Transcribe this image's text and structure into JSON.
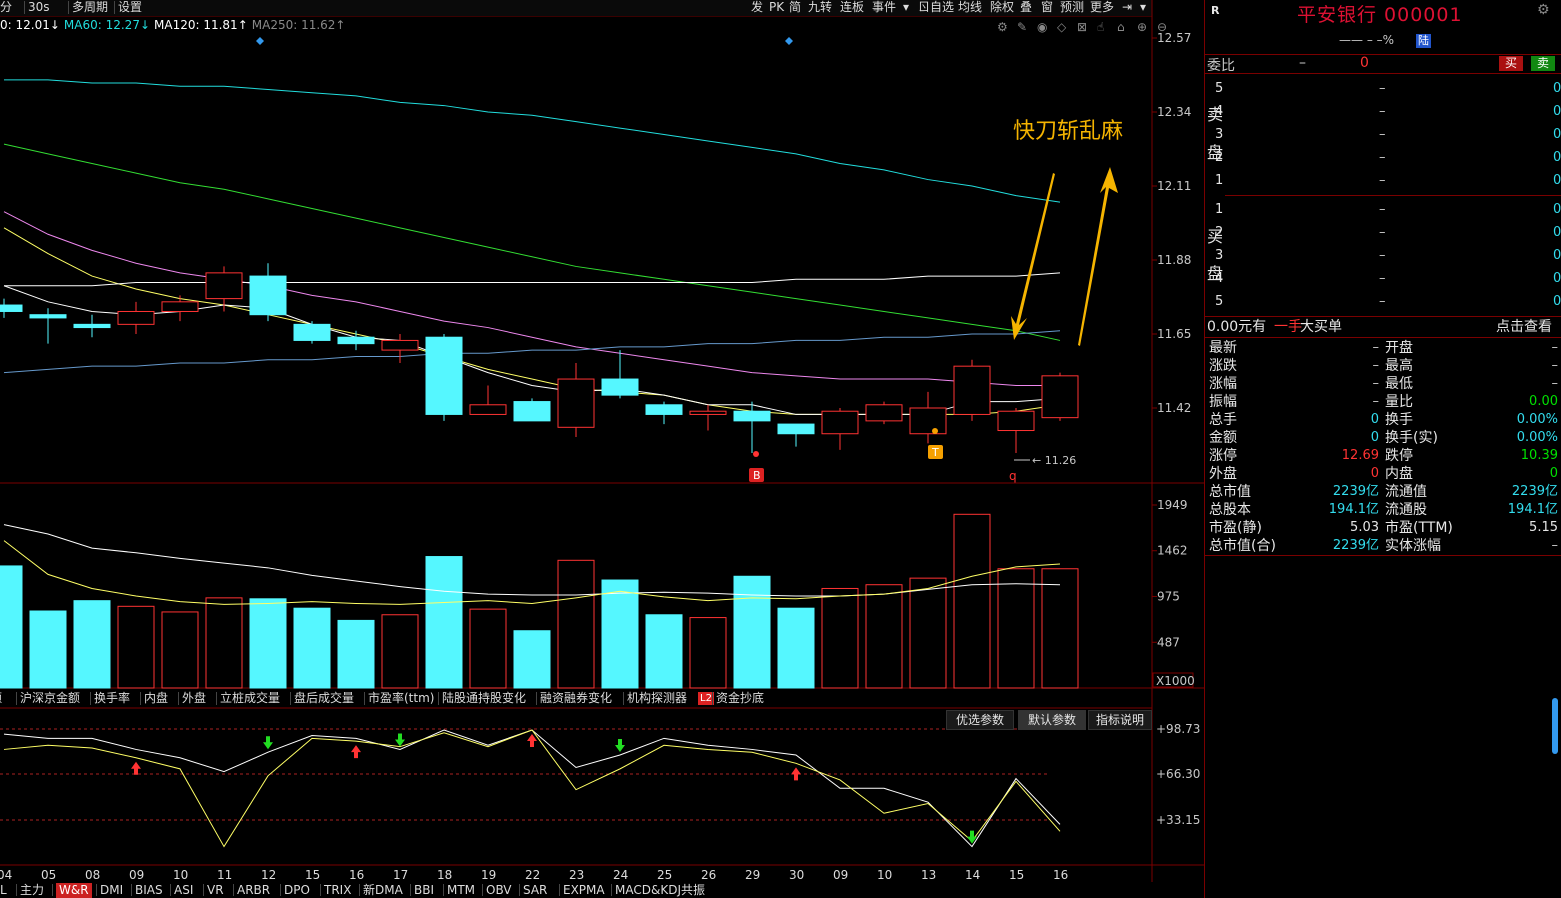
{
  "toolbar": {
    "left_items": [
      "分",
      "30s",
      "多周期",
      "设置"
    ],
    "right_items": [
      "发",
      "PK",
      "简",
      "九转",
      "连板",
      "事件",
      "▾",
      "ㄖ自选",
      "均线",
      "除权",
      "叠",
      "窗",
      "预测",
      "更多",
      "⇥",
      "▾"
    ]
  },
  "ma_legend": [
    {
      "label": "0: 12.01↓",
      "color": "#ffffff"
    },
    {
      "label": "MA60: 12.27↓",
      "color": "#22dddd"
    },
    {
      "label": "MA120: 11.81↑",
      "color": "#ffffff"
    },
    {
      "label": "MA250: 11.62↑",
      "color": "#888888"
    }
  ],
  "annotation": {
    "text": "快刀斩乱麻",
    "color": "#f5b400"
  },
  "markers": {
    "b": "B",
    "t": "T",
    "q": "q",
    "low_label": "11.26"
  },
  "chart_data": [
    {
      "type": "candlestick",
      "name": "price",
      "ylim": [
        11.2,
        12.62
      ],
      "y_ticks": [
        12.57,
        12.34,
        12.11,
        11.88,
        11.65,
        11.42
      ],
      "candles": [
        {
          "o": 11.74,
          "c": 11.72,
          "h": 11.76,
          "l": 11.7
        },
        {
          "o": 11.71,
          "c": 11.7,
          "h": 11.73,
          "l": 11.62
        },
        {
          "o": 11.68,
          "c": 11.67,
          "h": 11.71,
          "l": 11.64
        },
        {
          "o": 11.68,
          "c": 11.72,
          "h": 11.75,
          "l": 11.65
        },
        {
          "o": 11.72,
          "c": 11.75,
          "h": 11.77,
          "l": 11.69
        },
        {
          "o": 11.76,
          "c": 11.84,
          "h": 11.86,
          "l": 11.72
        },
        {
          "o": 11.83,
          "c": 11.71,
          "h": 11.87,
          "l": 11.69
        },
        {
          "o": 11.68,
          "c": 11.63,
          "h": 11.69,
          "l": 11.62
        },
        {
          "o": 11.64,
          "c": 11.62,
          "h": 11.66,
          "l": 11.6
        },
        {
          "o": 11.6,
          "c": 11.63,
          "h": 11.65,
          "l": 11.56
        },
        {
          "o": 11.64,
          "c": 11.4,
          "h": 11.65,
          "l": 11.38
        },
        {
          "o": 11.4,
          "c": 11.43,
          "h": 11.49,
          "l": 11.4
        },
        {
          "o": 11.44,
          "c": 11.38,
          "h": 11.45,
          "l": 11.38
        },
        {
          "o": 11.36,
          "c": 11.51,
          "h": 11.56,
          "l": 11.33
        },
        {
          "o": 11.51,
          "c": 11.46,
          "h": 11.6,
          "l": 11.45
        },
        {
          "o": 11.43,
          "c": 11.4,
          "h": 11.44,
          "l": 11.37
        },
        {
          "o": 11.4,
          "c": 11.41,
          "h": 11.43,
          "l": 11.35
        },
        {
          "o": 11.41,
          "c": 11.38,
          "h": 11.44,
          "l": 11.28
        },
        {
          "o": 11.37,
          "c": 11.34,
          "h": 11.37,
          "l": 11.3
        },
        {
          "o": 11.34,
          "c": 11.41,
          "h": 11.42,
          "l": 11.29
        },
        {
          "o": 11.38,
          "c": 11.43,
          "h": 11.44,
          "l": 11.37
        },
        {
          "o": 11.34,
          "c": 11.42,
          "h": 11.47,
          "l": 11.31
        },
        {
          "o": 11.4,
          "c": 11.55,
          "h": 11.57,
          "l": 11.38
        },
        {
          "o": 11.35,
          "c": 11.41,
          "h": 11.42,
          "l": 11.28
        },
        {
          "o": 11.39,
          "c": 11.52,
          "h": 11.53,
          "l": 11.38
        }
      ],
      "lines": [
        {
          "name": "ma-yellow",
          "color": "#ffff66",
          "values": [
            11.98,
            11.9,
            11.83,
            11.79,
            11.76,
            11.74,
            11.71,
            11.68,
            11.65,
            11.62,
            11.58,
            11.54,
            11.51,
            11.48,
            11.47,
            11.46,
            11.43,
            11.41,
            11.4,
            11.4,
            11.4,
            11.4,
            11.4,
            11.41,
            11.43
          ]
        },
        {
          "name": "ma-white-short",
          "color": "#ffffff",
          "values": [
            11.8,
            11.75,
            11.72,
            11.71,
            11.72,
            11.74,
            11.73,
            11.68,
            11.64,
            11.63,
            11.58,
            11.53,
            11.49,
            11.47,
            11.48,
            11.46,
            11.43,
            11.43,
            11.4,
            11.4,
            11.4,
            11.4,
            11.44,
            11.44,
            11.45
          ]
        },
        {
          "name": "ma-magenta",
          "color": "#ee88ee",
          "values": [
            12.03,
            11.96,
            11.91,
            11.87,
            11.84,
            11.82,
            11.8,
            11.77,
            11.75,
            11.72,
            11.69,
            11.67,
            11.64,
            11.61,
            11.59,
            11.57,
            11.55,
            11.53,
            11.52,
            11.51,
            11.51,
            11.51,
            11.5,
            11.49,
            11.49
          ]
        },
        {
          "name": "ma-green",
          "color": "#33dd33",
          "values": [
            12.24,
            12.21,
            12.18,
            12.15,
            12.12,
            12.1,
            12.07,
            12.04,
            12.01,
            11.98,
            11.95,
            11.92,
            11.89,
            11.86,
            11.84,
            11.82,
            11.8,
            11.78,
            11.76,
            11.74,
            11.72,
            11.7,
            11.68,
            11.66,
            11.63
          ]
        },
        {
          "name": "ma60-cyan",
          "color": "#22dddd",
          "values": [
            12.44,
            12.44,
            12.43,
            12.43,
            12.42,
            12.42,
            12.41,
            12.4,
            12.39,
            12.37,
            12.36,
            12.34,
            12.33,
            12.31,
            12.29,
            12.27,
            12.25,
            12.23,
            12.21,
            12.18,
            12.16,
            12.13,
            12.11,
            12.08,
            12.06
          ]
        },
        {
          "name": "ma120-white",
          "color": "#ffffff",
          "values": [
            11.8,
            11.8,
            11.8,
            11.81,
            11.81,
            11.81,
            11.81,
            11.81,
            11.81,
            11.81,
            11.81,
            11.81,
            11.81,
            11.81,
            11.81,
            11.81,
            11.81,
            11.81,
            11.82,
            11.82,
            11.82,
            11.83,
            11.83,
            11.83,
            11.84
          ]
        },
        {
          "name": "ma250-blue",
          "color": "#6699cc",
          "values": [
            11.53,
            11.54,
            11.55,
            11.55,
            11.56,
            11.56,
            11.57,
            11.57,
            11.58,
            11.58,
            11.59,
            11.59,
            11.6,
            11.6,
            11.61,
            11.61,
            11.62,
            11.62,
            11.63,
            11.63,
            11.64,
            11.64,
            11.65,
            11.65,
            11.66
          ]
        }
      ]
    },
    {
      "type": "bar",
      "name": "volume",
      "ylim": [
        0,
        2200
      ],
      "y_ticks": [
        1949,
        1462,
        975,
        487
      ],
      "unit": "X1000",
      "values": [
        1300,
        820,
        930,
        870,
        810,
        960,
        950,
        850,
        720,
        780,
        1400,
        840,
        610,
        1360,
        1150,
        780,
        750,
        1190,
        850,
        1060,
        1100,
        1170,
        1850,
        1270,
        1270
      ],
      "lines": [
        {
          "name": "vol-ma-white",
          "color": "#ffffff",
          "values": [
            1740,
            1640,
            1490,
            1440,
            1380,
            1330,
            1280,
            1200,
            1140,
            1080,
            1030,
            1000,
            990,
            990,
            1010,
            1020,
            1010,
            990,
            980,
            980,
            1000,
            1050,
            1100,
            1110,
            1100
          ]
        },
        {
          "name": "vol-ma-yellow",
          "color": "#ffff66",
          "values": [
            1570,
            1210,
            1060,
            980,
            920,
            890,
            900,
            920,
            900,
            890,
            910,
            930,
            900,
            960,
            1030,
            970,
            930,
            960,
            950,
            980,
            1000,
            1060,
            1190,
            1290,
            1320
          ]
        }
      ]
    },
    {
      "type": "line",
      "name": "W&R",
      "ylim": [
        10,
        105
      ],
      "y_ticks": [
        98.73,
        66.3,
        33.15
      ],
      "lines": [
        {
          "name": "wr-white",
          "color": "#ffffff",
          "values": [
            95,
            92,
            92,
            84,
            78,
            68,
            82,
            94,
            92,
            84,
            98,
            87,
            98,
            71,
            80,
            92,
            87,
            84,
            80,
            56,
            56,
            46,
            14,
            63,
            30
          ]
        },
        {
          "name": "wr-yellow",
          "color": "#ffff66",
          "values": [
            84,
            87,
            85,
            78,
            70,
            14,
            65,
            92,
            90,
            86,
            96,
            86,
            98,
            55,
            70,
            87,
            84,
            82,
            74,
            62,
            38,
            45,
            18,
            61,
            25
          ]
        }
      ],
      "buy_signals": [
        3,
        8,
        12,
        18
      ],
      "sell_signals": [
        6,
        9,
        14,
        22
      ]
    }
  ],
  "x_labels": [
    "04",
    "05",
    "08",
    "09",
    "10",
    "11",
    "12",
    "15",
    "16",
    "17",
    "18",
    "19",
    "22",
    "23",
    "24",
    "25",
    "26",
    "29",
    "30",
    "09",
    "10",
    "13",
    "14",
    "15",
    "16"
  ],
  "indicator_tabs": [
    "额",
    "沪深京金额",
    "换手率",
    "内盘",
    "外盘",
    "立桩成交量",
    "盘后成交量",
    "市盈率(ttm)",
    "陆股通持股变化",
    "融资融券变化",
    "机构探测器",
    "资金抄底"
  ],
  "l2_label": "L2",
  "param_buttons": [
    "优选参数",
    "默认参数",
    "指标说明"
  ],
  "bottom_tabs": [
    "L",
    "主力",
    "W&R",
    "DMI",
    "BIAS",
    "ASI",
    "VR",
    "ARBR",
    "DPO",
    "TRIX",
    "新DMA",
    "BBI",
    "MTM",
    "OBV",
    "SAR",
    "EXPMA",
    "MACD&KDJ共振"
  ],
  "right_panel": {
    "r_label": "R",
    "stock_title": "平安银行 000001",
    "price_line": "—— – –% ",
    "lu_badge": "陆",
    "weibi_label": "委比",
    "weibi_dash": "–",
    "weibi_value": "0",
    "buy_btn": "买",
    "sell_btn": "卖",
    "sell_side_label": [
      "卖",
      "盘"
    ],
    "buy_side_label": [
      "买",
      "盘"
    ],
    "sell_levels": [
      "5",
      "4",
      "3",
      "2",
      "1"
    ],
    "buy_levels": [
      "1",
      "2",
      "3",
      "4",
      "5"
    ],
    "level_price": "–",
    "level_vol": "0",
    "big_order": {
      "amount": "0.00元有",
      "hand": "一手",
      "label": "大买单",
      "link": "点击查看"
    },
    "stats": [
      {
        "l1": "最新",
        "v1": "–",
        "l2": "开盘",
        "v2": "–",
        "c1": "gray",
        "c2": "gray"
      },
      {
        "l1": "涨跌",
        "v1": "–",
        "l2": "最高",
        "v2": "–",
        "c1": "gray",
        "c2": "gray"
      },
      {
        "l1": "涨幅",
        "v1": "–",
        "l2": "最低",
        "v2": "–",
        "c1": "gray",
        "c2": "gray"
      },
      {
        "l1": "振幅",
        "v1": "–",
        "l2": "量比",
        "v2": "0.00",
        "c1": "gray",
        "c2": "green"
      },
      {
        "l1": "总手",
        "v1": "0",
        "l2": "换手",
        "v2": "0.00%",
        "c1": "cyan",
        "c2": "cyan"
      },
      {
        "l1": "金额",
        "v1": "0",
        "l2": "换手(实)",
        "v2": "0.00%",
        "c1": "cyan",
        "c2": "cyan"
      },
      {
        "l1": "涨停",
        "v1": "12.69",
        "l2": "跌停",
        "v2": "10.39",
        "c1": "red",
        "c2": "green"
      },
      {
        "l1": "外盘",
        "v1": "0",
        "l2": "内盘",
        "v2": "0",
        "c1": "red",
        "c2": "green"
      },
      {
        "l1": "总市值",
        "v1": "2239亿",
        "l2": "流通值",
        "v2": "2239亿",
        "c1": "cyan",
        "c2": "cyan"
      },
      {
        "l1": "总股本",
        "v1": "194.1亿",
        "l2": "流通股",
        "v2": "194.1亿",
        "c1": "cyan",
        "c2": "cyan"
      },
      {
        "l1": "市盈(静)",
        "v1": "5.03",
        "l2": "市盈(TTM)",
        "v2": "5.15",
        "c1": "white",
        "c2": "white"
      },
      {
        "l1": "总市值(合)",
        "v1": "2239亿",
        "l2": "实体涨幅",
        "v2": "–",
        "c1": "cyan",
        "c2": "gray"
      }
    ]
  },
  "colors": {
    "up": "#ff3333",
    "down": "#55f7ff",
    "grid": "#7a0000",
    "axis_text": "#c8c8c8"
  }
}
